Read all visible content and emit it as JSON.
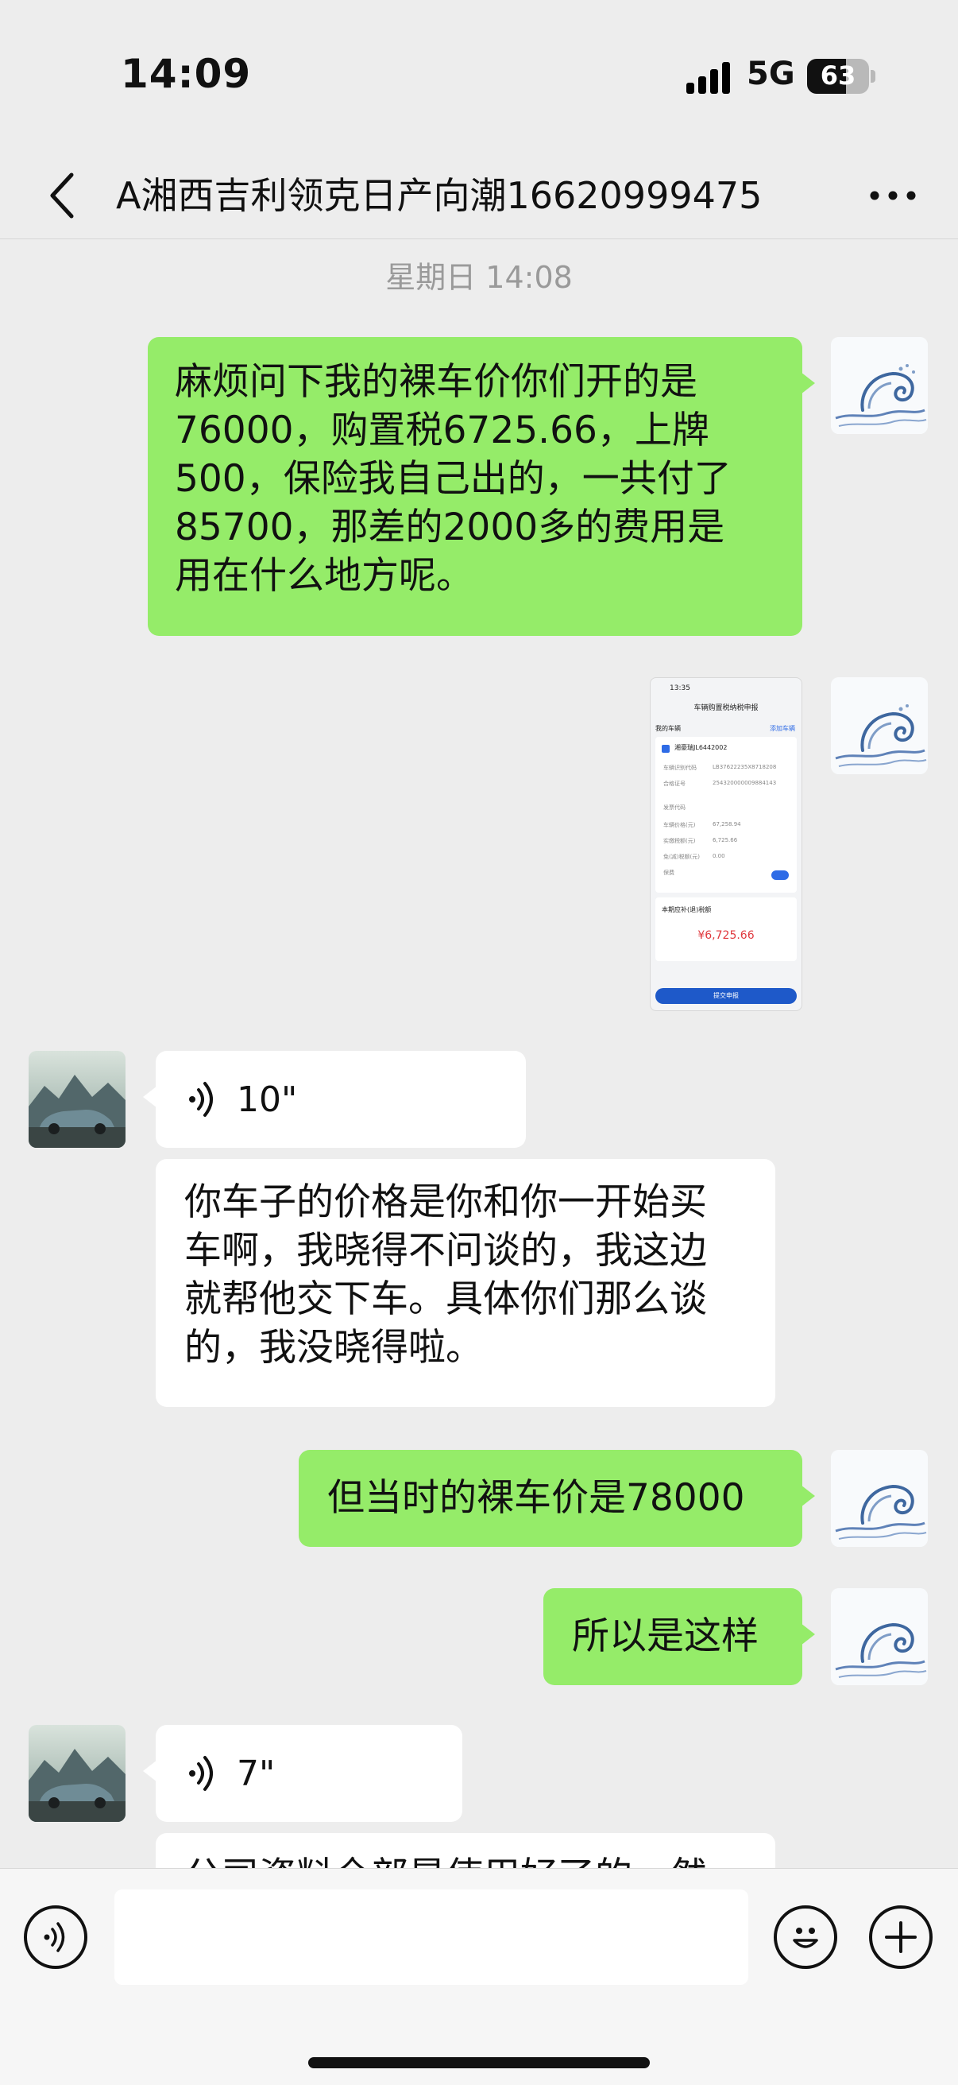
{
  "status_bar": {
    "time": "14:09",
    "network": "5G",
    "battery": "63",
    "battery_level": 0.63
  },
  "nav": {
    "title": "A湘西吉利领克日产向潮16620999475"
  },
  "timestamp": "星期日 14:08",
  "messages": {
    "m1": {
      "text": "麻烦问下我的裸车价你们开的是\n76000，购置税6725.66，上牌\n500，保险我自己出的，一共付了\n85700，那差的2000多的费用是\n用在什么地方呢。"
    },
    "m2_image": {
      "time": "13:35",
      "title": "车辆购置税纳税申报",
      "my_cars": "我的车辆",
      "add": "添加车辆",
      "plate": "湘豪瑞JL6442002",
      "rows": [
        "车辆识别代码",
        "合格证号",
        "发票代码",
        "车辆价格(元)",
        "实缴税额(元)",
        "免(减)税额(元)",
        "保费"
      ],
      "values": [
        "LB37622235X8718208",
        "254320000009884143",
        "",
        "67,258.94",
        "6,725.66",
        "0.00",
        ""
      ],
      "amount_label": "本期应补(退)税额",
      "amount": "¥6,725.66",
      "submit": "提交申报"
    },
    "m3": {
      "duration": "10\""
    },
    "m4": {
      "text": "你车子的价格是你和你一开始买\n车啊，我晓得不问谈的，我这边\n就帮他交下车。具体你们那么谈\n的，我没晓得啦。"
    },
    "m5": {
      "text": "但当时的裸车价是78000"
    },
    "m6": {
      "text": "所以是这样"
    },
    "m7": {
      "duration": "7\""
    },
    "m8": {
      "text": "公司资料全部是使用好了的，然"
    }
  },
  "input": {
    "placeholder": ""
  },
  "icons": [
    "signal-icon",
    "battery-icon",
    "back-icon",
    "more-icon",
    "voice-icon",
    "emoji-icon",
    "plus-icon",
    "avatar-wave",
    "avatar-car"
  ]
}
